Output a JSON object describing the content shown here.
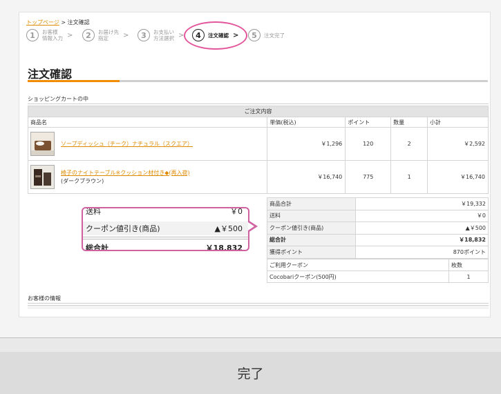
{
  "breadcrumb": {
    "home": "トップページ",
    "sep": " > ",
    "current": "注文確認"
  },
  "steps": [
    {
      "num": "1",
      "label": "お客様\n情報入力",
      "active": false
    },
    {
      "num": "2",
      "label": "お届け先\n指定",
      "active": false
    },
    {
      "num": "3",
      "label": "お支払い\n方法選択",
      "active": false
    },
    {
      "num": "4",
      "label": "注文確認",
      "active": true
    },
    {
      "num": "5",
      "label": "注文完了",
      "active": false
    }
  ],
  "arrow": ">",
  "page_title": "注文確認",
  "cart_section_label": "ショッピングカートの中",
  "order_table": {
    "caption": "ご注文内容",
    "headers": [
      "商品名",
      "単価(税込)",
      "ポイント",
      "数量",
      "小計"
    ],
    "rows": [
      {
        "name": "ソープディッシュ（チーク）ナチュラル（スクエア）",
        "variant": "",
        "price": "￥1,296",
        "points": "120",
        "qty": "2",
        "subtotal": "￥2,592"
      },
      {
        "name": "椅子のナイトテーブル※クッション材付き◆(再入荷)",
        "variant": "(ダークブラウン)",
        "price": "￥16,740",
        "points": "775",
        "qty": "1",
        "subtotal": "￥16,740"
      }
    ]
  },
  "summary": {
    "rows": [
      {
        "label": "商品合計",
        "value": "￥19,332"
      },
      {
        "label": "送料",
        "value": "￥0"
      },
      {
        "label": "クーポン値引き(商品)",
        "value": "▲￥500"
      },
      {
        "label": "総合計",
        "value": "￥18,832"
      },
      {
        "label": "獲得ポイント",
        "value": "870ポイント"
      }
    ]
  },
  "coupon_table": {
    "headers": [
      "ご利用クーポン",
      "枚数"
    ],
    "rows": [
      {
        "name": "Cocobariクーポン(500円)",
        "count": "1"
      }
    ]
  },
  "callout": {
    "shipping_label": "送料",
    "shipping_value": "￥0",
    "coupon_label": "クーポン値引き(商品)",
    "coupon_value": "▲￥500",
    "total_label": "総合計",
    "total_value": "￥18,832"
  },
  "customer_section_label": "お客様の情報",
  "caption": "完了",
  "colors": {
    "accent_orange": "#f08c00",
    "link_orange": "#e08a00",
    "highlight_pink": "#e3559a"
  }
}
